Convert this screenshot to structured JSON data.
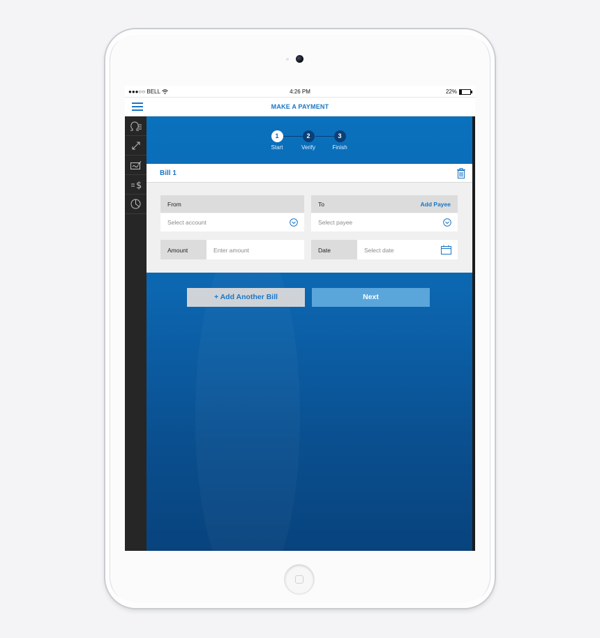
{
  "status_bar": {
    "carrier": "●●●○○ BELL",
    "time": "4:26 PM",
    "battery": "22%",
    "battery_level": 0.22
  },
  "nav": {
    "title": "MAKE A PAYMENT",
    "menu_icon": "hamburger-icon"
  },
  "sidebar": {
    "items": [
      {
        "icon": "accounts-icon"
      },
      {
        "icon": "transfer-icon"
      },
      {
        "icon": "pay-bill-icon"
      },
      {
        "icon": "money-icon"
      },
      {
        "icon": "pie-chart-icon"
      }
    ]
  },
  "stepper": {
    "steps": [
      {
        "number": "1",
        "label": "Start",
        "active": true
      },
      {
        "number": "2",
        "label": "Verify",
        "active": false
      },
      {
        "number": "3",
        "label": "Finish",
        "active": false
      }
    ]
  },
  "bill": {
    "title": "Bill 1",
    "delete_icon": "trash-icon",
    "from_label": "From",
    "from_placeholder": "Select account",
    "to_label": "To",
    "add_payee": "Add Payee",
    "to_placeholder": "Select payee",
    "amount_label": "Amount",
    "amount_placeholder": "Enter amount",
    "date_label": "Date",
    "date_placeholder": "Select date",
    "calendar_icon": "calendar-icon"
  },
  "actions": {
    "add_bill": "+ Add Another Bill",
    "next": "Next"
  },
  "colors": {
    "accent": "#1b75c4",
    "header_blue": "#0a71bd",
    "sidebar": "#262626"
  }
}
